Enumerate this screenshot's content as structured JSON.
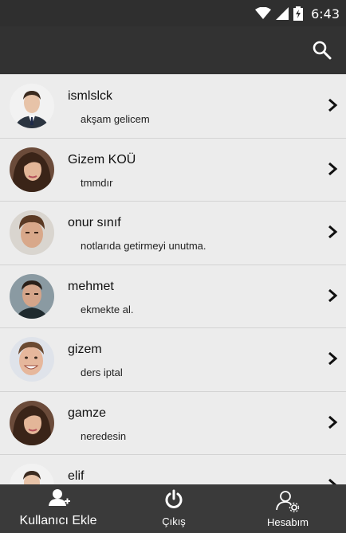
{
  "status": {
    "time": "6:43",
    "icons": [
      "wifi-icon",
      "cell-signal-icon",
      "battery-charging-icon"
    ]
  },
  "appbar": {
    "actions": [
      "search-icon"
    ]
  },
  "contacts": [
    {
      "name": "ismlslck",
      "message": "akşam gelicem",
      "avatar": "man-suit"
    },
    {
      "name": "Gizem KOÜ",
      "message": "tmmdır",
      "avatar": "woman-dark-hair"
    },
    {
      "name": "onur sınıf",
      "message": "notlarıda getirmeyi unutma.",
      "avatar": "man-brown-hair"
    },
    {
      "name": "mehmet",
      "message": "ekmekte al.",
      "avatar": "man-short-hair"
    },
    {
      "name": "gizem",
      "message": "ders iptal",
      "avatar": "man-smiling"
    },
    {
      "name": "gamze",
      "message": "neredesin",
      "avatar": "woman-dark-hair"
    },
    {
      "name": "elif",
      "message": "",
      "avatar": "man-suit"
    }
  ],
  "bottom_nav": {
    "add_user": "Kullanıcı Ekle",
    "logout": "Çıkış",
    "account": "Hesabım"
  },
  "colors": {
    "status_bar": "#2f2f2f",
    "app_bar": "#323232",
    "list_bg": "#ececec",
    "bottom_bar": "#3a3a3a"
  }
}
